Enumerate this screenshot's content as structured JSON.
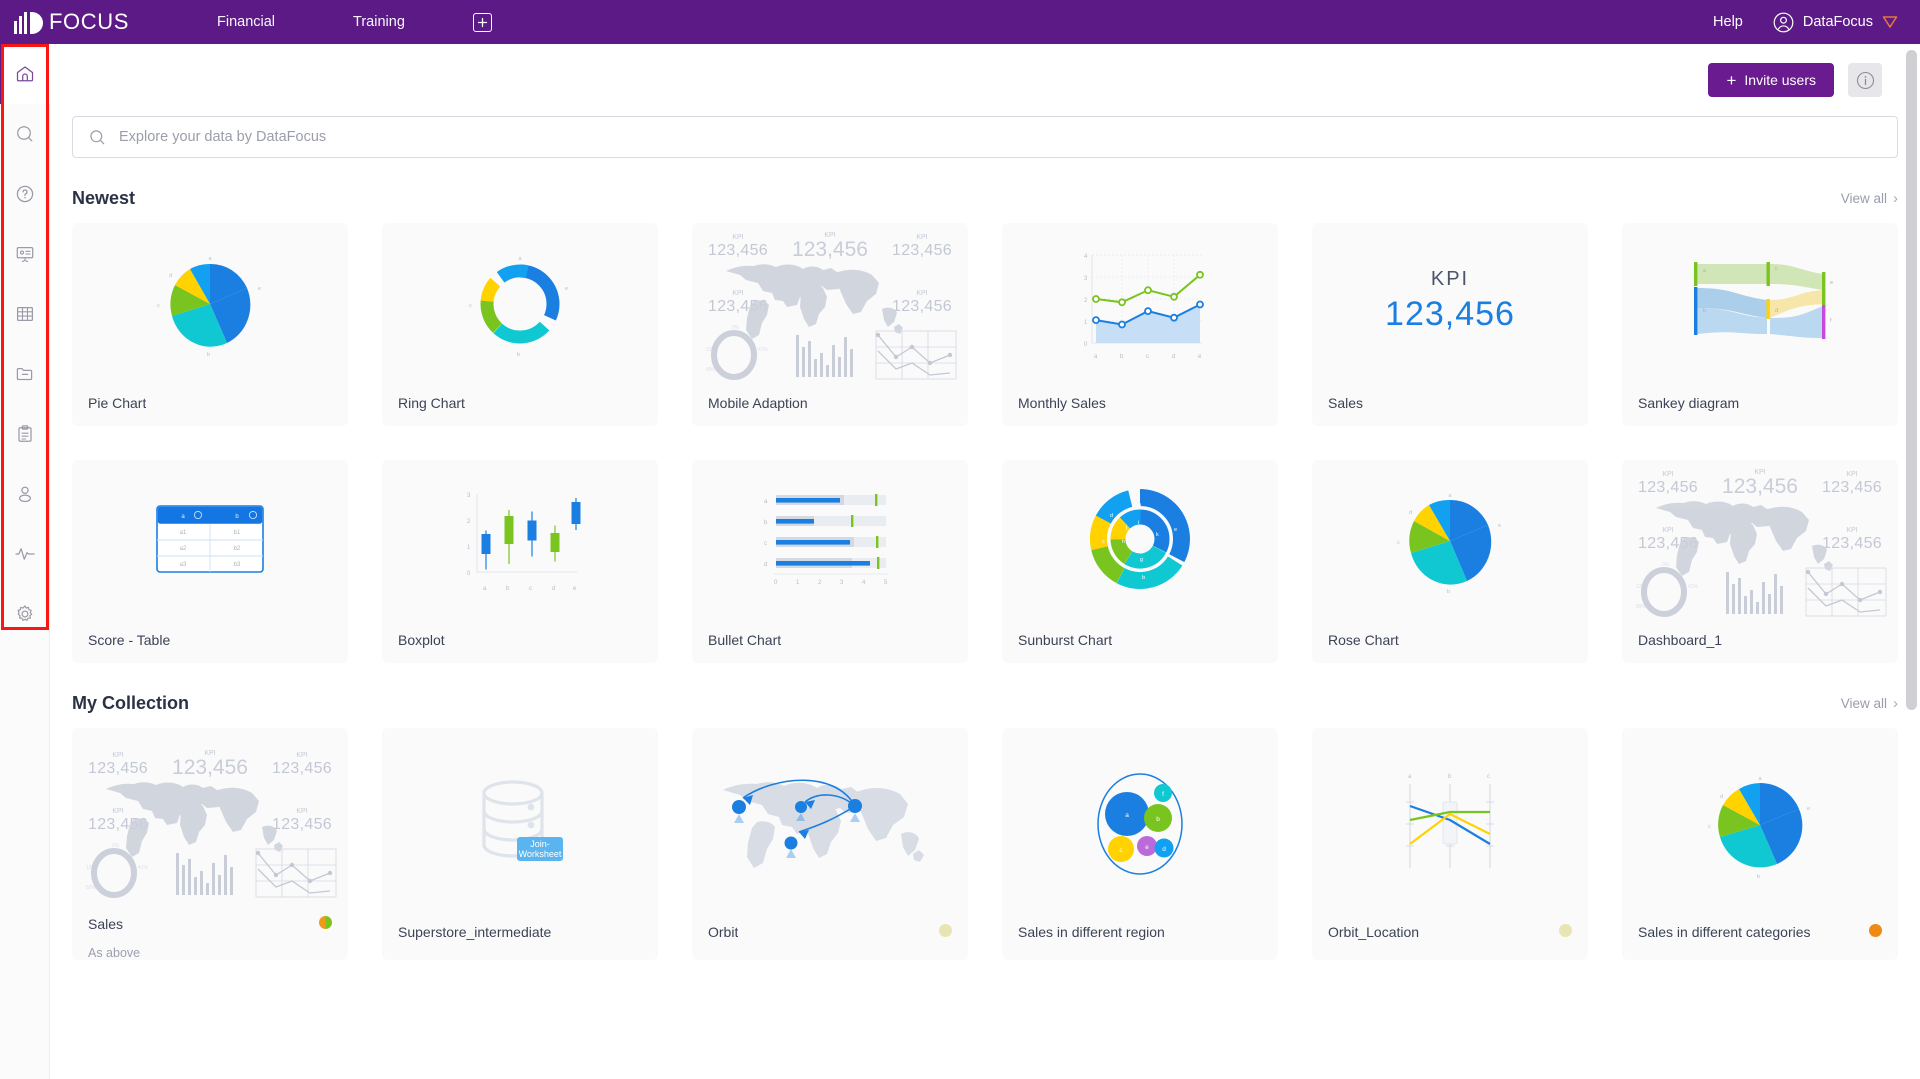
{
  "topbar": {
    "brand": "FOCUS",
    "nav": [
      {
        "label": "Financial",
        "name": "nav-financial"
      },
      {
        "label": "Training",
        "name": "nav-training"
      }
    ],
    "add_label": "+",
    "help_label": "Help",
    "user_name": "DataFocus"
  },
  "sidebar": {
    "items": [
      {
        "icon": "home-icon",
        "name": "sidebar-item-home",
        "active": true
      },
      {
        "icon": "search-icon",
        "name": "sidebar-item-search",
        "active": false
      },
      {
        "icon": "question-icon",
        "name": "sidebar-item-help",
        "active": false
      },
      {
        "icon": "presentation-icon",
        "name": "sidebar-item-presentation",
        "active": false
      },
      {
        "icon": "grid-icon",
        "name": "sidebar-item-table",
        "active": false
      },
      {
        "icon": "folder-icon",
        "name": "sidebar-item-folder",
        "active": false
      },
      {
        "icon": "clipboard-icon",
        "name": "sidebar-item-clipboard",
        "active": false
      },
      {
        "icon": "user-icon",
        "name": "sidebar-item-user",
        "active": false
      },
      {
        "icon": "pulse-icon",
        "name": "sidebar-item-activity",
        "active": false
      },
      {
        "icon": "gear-icon",
        "name": "sidebar-item-settings",
        "active": false
      }
    ]
  },
  "toolbar": {
    "invite_label": "Invite users",
    "invite_plus": "+",
    "info_icon": "info-icon"
  },
  "search": {
    "placeholder": "Explore your data by DataFocus",
    "icon": "search-icon"
  },
  "sections": [
    {
      "title": "Newest",
      "view_all": "View all",
      "cards": [
        {
          "name": "Pie Chart",
          "thumb": "pie"
        },
        {
          "name": "Ring Chart",
          "thumb": "ring"
        },
        {
          "name": "Mobile Adaption",
          "thumb": "dashboard"
        },
        {
          "name": "Monthly Sales",
          "thumb": "line-area"
        },
        {
          "name": "Sales",
          "thumb": "kpi"
        },
        {
          "name": "Sankey diagram",
          "thumb": "sankey"
        },
        {
          "name": "Score - Table",
          "thumb": "table"
        },
        {
          "name": "Boxplot",
          "thumb": "boxplot"
        },
        {
          "name": "Bullet Chart",
          "thumb": "bullet"
        },
        {
          "name": "Sunburst Chart",
          "thumb": "sunburst"
        },
        {
          "name": "Rose Chart",
          "thumb": "pie2"
        },
        {
          "name": "Dashboard_1",
          "thumb": "dashboard"
        }
      ]
    },
    {
      "title": "My Collection",
      "view_all": "View all",
      "cards": [
        {
          "name": "Sales",
          "thumb": "dashboard",
          "subtitle": "As above",
          "dot": "duo"
        },
        {
          "name": "Superstore_intermediate",
          "thumb": "worksheet",
          "dot": null
        },
        {
          "name": "Orbit",
          "thumb": "orbit",
          "dot": "pale"
        },
        {
          "name": "Sales in different region",
          "thumb": "bubble",
          "dot": null
        },
        {
          "name": "Orbit_Location",
          "thumb": "parallel",
          "dot": "pale"
        },
        {
          "name": "Sales in different categories",
          "thumb": "pie3",
          "dot": "orange"
        }
      ]
    }
  ],
  "thumb_text": {
    "kpi_label": "KPI",
    "kpi_value": "123,456",
    "join_worksheet_line1": "Join-",
    "join_worksheet_line2": "Worksheet"
  },
  "colors": {
    "brand_purple": "#5b1a86",
    "invite_purple": "#6a1b8f",
    "series_blue": "#1a7fe0",
    "series_cyan": "#10c8d2",
    "series_green": "#7ac41f",
    "series_yellow": "#ffd200",
    "series_lightblue": "#12a0f0",
    "series_purple": "#bb6bd9",
    "annotation_red": "#fb1616"
  },
  "chart_data": [
    {
      "type": "pie",
      "title": "Pie Chart",
      "labels": [
        "a",
        "b",
        "c",
        "d",
        "e"
      ],
      "values": [
        30,
        27,
        15,
        10,
        18
      ],
      "colors": [
        "#1a7fe0",
        "#10c8d2",
        "#7ac41f",
        "#ffd200",
        "#12a0f0"
      ]
    },
    {
      "type": "pie",
      "title": "Ring Chart",
      "labels": [
        "a",
        "b",
        "c",
        "d",
        "e"
      ],
      "values": [
        30,
        27,
        15,
        10,
        18
      ],
      "colors": [
        "#1a7fe0",
        "#10c8d2",
        "#7ac41f",
        "#ffd200",
        "#12a0f0"
      ],
      "donut": true
    },
    {
      "type": "line",
      "title": "Monthly Sales",
      "categories": [
        "a",
        "b",
        "c",
        "d",
        "e"
      ],
      "series": [
        {
          "name": "green",
          "values": [
            2.0,
            1.85,
            2.4,
            2.1,
            3.1
          ],
          "color": "#7ac41f"
        },
        {
          "name": "blue",
          "values": [
            1.05,
            0.85,
            1.45,
            1.15,
            1.75
          ],
          "color": "#1a7fe0",
          "area": true
        }
      ],
      "ylim": [
        0,
        4
      ],
      "yticks": [
        0,
        1,
        2,
        3,
        4
      ],
      "grid": true
    },
    {
      "type": "table",
      "title": "Score - Table",
      "columns": [
        "a",
        "b"
      ],
      "rows": [
        [
          "a1",
          "b1"
        ],
        [
          "a2",
          "b2"
        ],
        [
          "a3",
          "b3"
        ]
      ]
    },
    {
      "type": "boxplot",
      "title": "Boxplot",
      "categories": [
        "a",
        "b",
        "c",
        "d",
        "e"
      ],
      "boxes": [
        {
          "low": 0.1,
          "q1": 0.6,
          "q3": 1.45,
          "high": 1.85,
          "color": "#1a7fe0"
        },
        {
          "low": 0.3,
          "q1": 1.05,
          "q3": 2.15,
          "high": 2.6,
          "color": "#7ac41f"
        },
        {
          "low": 0.6,
          "q1": 1.2,
          "q3": 1.95,
          "high": 2.35,
          "color": "#1a7fe0"
        },
        {
          "low": 0.4,
          "q1": 0.7,
          "q3": 1.45,
          "high": 1.75,
          "color": "#7ac41f"
        },
        {
          "low": 1.6,
          "q1": 2.15,
          "q3": 2.7,
          "high": 2.95,
          "color": "#1a7fe0"
        }
      ],
      "ylim": [
        0,
        3
      ],
      "yticks": [
        0,
        1,
        2,
        3
      ]
    },
    {
      "type": "bar",
      "title": "Bullet Chart",
      "categories": [
        "a",
        "b",
        "c",
        "d"
      ],
      "values": [
        2.9,
        1.75,
        3.35,
        4.25
      ],
      "markers": [
        4.5,
        3.4,
        4.55,
        4.6
      ],
      "xticks": [
        0,
        1,
        2,
        3,
        4,
        5
      ],
      "xlim": [
        0,
        5
      ]
    },
    {
      "type": "pie",
      "title": "Sunburst Chart",
      "inner_labels": [
        "i",
        "k",
        "g",
        "h",
        "j"
      ],
      "outer_labels": [
        "a",
        "e",
        "f",
        "c",
        "d"
      ],
      "colors": [
        "#1a7fe0",
        "#10c8d2",
        "#7ac41f",
        "#ffd200",
        "#12a0f0"
      ]
    },
    {
      "type": "pie",
      "title": "Rose Chart",
      "labels": [
        "a",
        "b",
        "c",
        "d",
        "e"
      ],
      "values": [
        30,
        27,
        15,
        10,
        18
      ],
      "colors": [
        "#1a7fe0",
        "#10c8d2",
        "#7ac41f",
        "#ffd200",
        "#12a0f0"
      ]
    },
    {
      "type": "scatter",
      "title": "Sales in different region",
      "labels": [
        "a",
        "b",
        "c",
        "d",
        "e",
        "f"
      ],
      "sizes": [
        34,
        21,
        17,
        13,
        12,
        10
      ],
      "colors": [
        "#1a7fe0",
        "#7ac41f",
        "#ffd200",
        "#12a0f0",
        "#bb6bd9",
        "#10c8d2"
      ]
    },
    {
      "type": "line",
      "title": "Orbit_Location",
      "axes": [
        "a",
        "b",
        "c"
      ],
      "series": [
        {
          "name": "blue",
          "values": [
            2.55,
            2.1,
            1.2
          ],
          "color": "#1a7fe0"
        },
        {
          "name": "green",
          "values": [
            1.75,
            2.1,
            2.1
          ],
          "color": "#7ac41f"
        },
        {
          "name": "yellow",
          "values": [
            0.7,
            2.0,
            1.0
          ],
          "color": "#ffd200"
        }
      ]
    },
    {
      "type": "pie",
      "title": "Sales in different categories",
      "labels": [
        "a",
        "b",
        "c",
        "d",
        "e"
      ],
      "values": [
        30,
        27,
        15,
        10,
        18
      ],
      "colors": [
        "#1a7fe0",
        "#10c8d2",
        "#7ac41f",
        "#ffd200",
        "#12a0f0"
      ]
    },
    {
      "type": "area",
      "title": "Sankey diagram",
      "nodes": [
        "a",
        "b",
        "c",
        "d",
        "e",
        "f"
      ],
      "colors": [
        "#7ac41f",
        "#1a7fe0",
        "#7ac41f",
        "#ffd200",
        "#7ac41f",
        "#c64ae0"
      ]
    }
  ]
}
